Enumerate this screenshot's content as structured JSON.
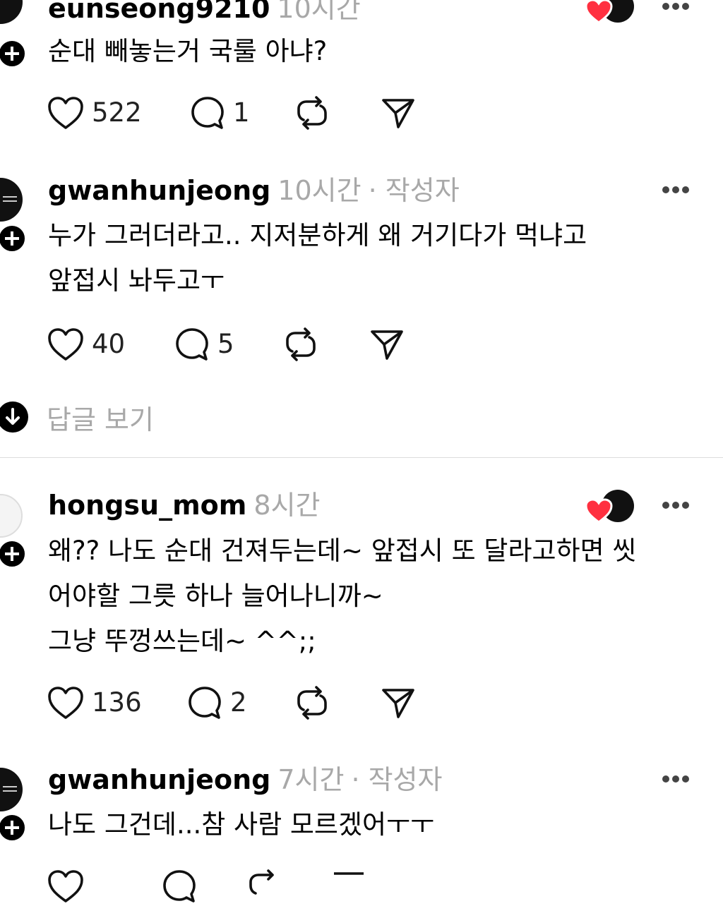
{
  "posts": [
    {
      "username": "eunseong9210",
      "time": "10시간",
      "author_tag": "",
      "lines": [
        "순대 빼놓는거 국룰 아냐?"
      ],
      "likes": "522",
      "comments": "1",
      "liked_by_author": true,
      "avatar_icon": "profile-avatar-dark"
    },
    {
      "username": "gwanhunjeong",
      "time": "10시간",
      "author_tag": "· 작성자",
      "lines": [
        "누가 그러더라고.. 지저분하게 왜 거기다가 먹냐고",
        "앞접시 놔두고ㅜ"
      ],
      "likes": "40",
      "comments": "5",
      "liked_by_author": false,
      "avatar_icon": "profile-avatar-dark"
    },
    {
      "username": "hongsu_mom",
      "time": "8시간",
      "author_tag": "",
      "lines": [
        "왜?? 나도 순대 건져두는데~ 앞접시 또 달라고하면 씻",
        "어야할 그릇 하나 늘어나니까~",
        "그냥 뚜껑쓰는데~ ^^;;"
      ],
      "likes": "136",
      "comments": "2",
      "liked_by_author": true,
      "avatar_icon": "profile-avatar-light"
    },
    {
      "username": "gwanhunjeong",
      "time": "7시간",
      "author_tag": "· 작성자",
      "lines": [
        "나도 그건데...참 사람 모르겠어ㅜㅜ"
      ],
      "likes": "",
      "comments": "",
      "liked_by_author": false,
      "avatar_icon": "profile-avatar-dark"
    }
  ],
  "replies_link": {
    "label": "답글 보기",
    "icon": "arrow-down-circle-icon"
  },
  "colors": {
    "text": "#000000",
    "muted": "#a8a8a8",
    "heart_red": "#ff3040",
    "divider": "#dddddd"
  },
  "icons": {
    "like": "heart-outline-icon",
    "comment": "comment-bubble-icon",
    "repost": "repost-icon",
    "share": "send-icon",
    "more": "more-dots-icon",
    "follow": "plus-icon"
  }
}
